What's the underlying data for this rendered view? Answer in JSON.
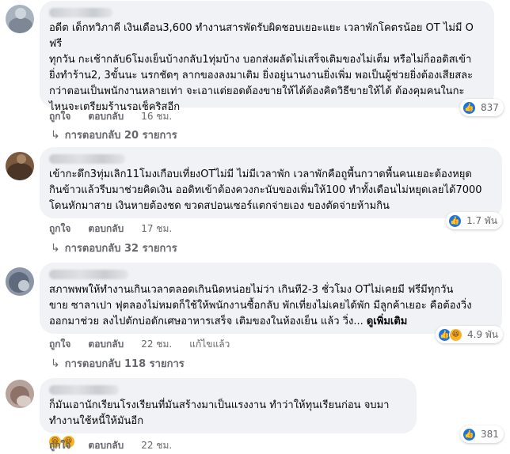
{
  "comments": [
    {
      "text": "อดีต เด็กทวิภาคี เงินเดือน3,600 ทำงานสารพัดรับผิดชอบเยอะแยะ เวลาพักโคตรน้อย OT ไม่มี O ฟรี\nทุกวัน กะเช้ากลับ6โมงเย็นบ้างกลับ1ทุ่มบ้าง บอกส่งผลัดไม่เสร็จเติมของไม่เต็ม หรือไม่ก็ออดิสเข้า\nยิ่งทำร้าน2, 3ขั้นนะ นรกชัดๆ ลากของลงมาเติม ยิ่งอยู่นานงานยิ่งเพิ่ม พอเป็นผู้ช่วยยิ่งต้องเสียสละ\nกว่าตอนเป็นพนักงานหลายเท่า จะเอาแต่ยอดต้องขายให้ได้ต้องคิดวิธีขายให้ได้ ต้องคุมคนในกะ\nไหนจะเตรียมร้านรอเช็คริสอีก",
      "see_more": "",
      "reaction_count": "837",
      "reaction_types": [
        "like"
      ],
      "like_label": "ถูกใจ",
      "reply_label": "ตอบกลับ",
      "time": "16 ชม.",
      "edited": "",
      "replies_label": "การตอบกลับ 20 รายการ"
    },
    {
      "text": "เข้ากะดึก3ทุ่มเลิก11โมงเกือบเที่ยงOTไม่มี ไม่มีเวลาพัก เวลาพักคือถูพื้นกวาดพื้นคนเยอะต้องหยุด\nกินข้าวแล้วรีบมาช่วยคิดเงิน ออดิทเข้าต้องควงกะนับของเพิ่มให้100 ทำทั้งเดือนไม่หยุดเลยได้7000\nโดนหักมาสาย เงินหายต้องชด ขวดสปอนเซอร์แตกจ่ายเอง ของตัดจ่ายห้ามกิน",
      "see_more": "",
      "reaction_count": "1.7 พัน",
      "reaction_types": [
        "like"
      ],
      "like_label": "ถูกใจ",
      "reply_label": "ตอบกลับ",
      "time": "17 ชม.",
      "edited": "",
      "replies_label": "การตอบกลับ 32 รายการ"
    },
    {
      "text": "สภาพพพให้ทำงานเกินเวลาตลอดเกินนิดหน่อยไม่ว่า เกินที2-3 ชั่วโมง OTไม่เคยมี ฟรีมีทุกวัน\nขาย ซาลาเปา ฟุตลองไม่หมดก็ใช้ให้พนักงานซื้อกลับ พักเที่ยงไม่เคยได้พัก มีลูกค้าเยอะ คือต้องวิ่ง\nออกมาช่วย ลงไปตักบ่อดักเศษอาหารเสร็จ เติมของในห้องเย็น แล้ว วิ่ง...",
      "see_more": "ดูเพิ่มเติม",
      "reaction_count": "4.9 พัน",
      "reaction_types": [
        "like",
        "haha"
      ],
      "like_label": "ถูกใจ",
      "reply_label": "ตอบกลับ",
      "time": "22 ชม.",
      "edited": "แก้ไขแล้ว",
      "replies_label": "การตอบกลับ 118 รายการ"
    },
    {
      "text": "ก็มันเอานักเรียนโรงเรียนที่มันสร้างมาเป็นแรงงาน ทำว่าให้ทุนเรียนก่อน จบมาทำงานใช้หนี้ให้มันอีก",
      "see_more": "",
      "reaction_count": "381",
      "reaction_types": [
        "like"
      ],
      "like_label": "ถูกใจ",
      "reply_label": "ตอบกลับ",
      "time": "22 ชม.",
      "edited": "",
      "replies_label": ""
    }
  ],
  "colors": {
    "bubble": "#f0f2f5",
    "like": "#1b74e4",
    "haha": "#f7b125",
    "muted": "#65676b"
  },
  "icons": {
    "like": "thumbs-up-icon",
    "haha": "laughing-face-icon",
    "reply": "reply-arrow-icon",
    "more": "more-dots-icon"
  }
}
